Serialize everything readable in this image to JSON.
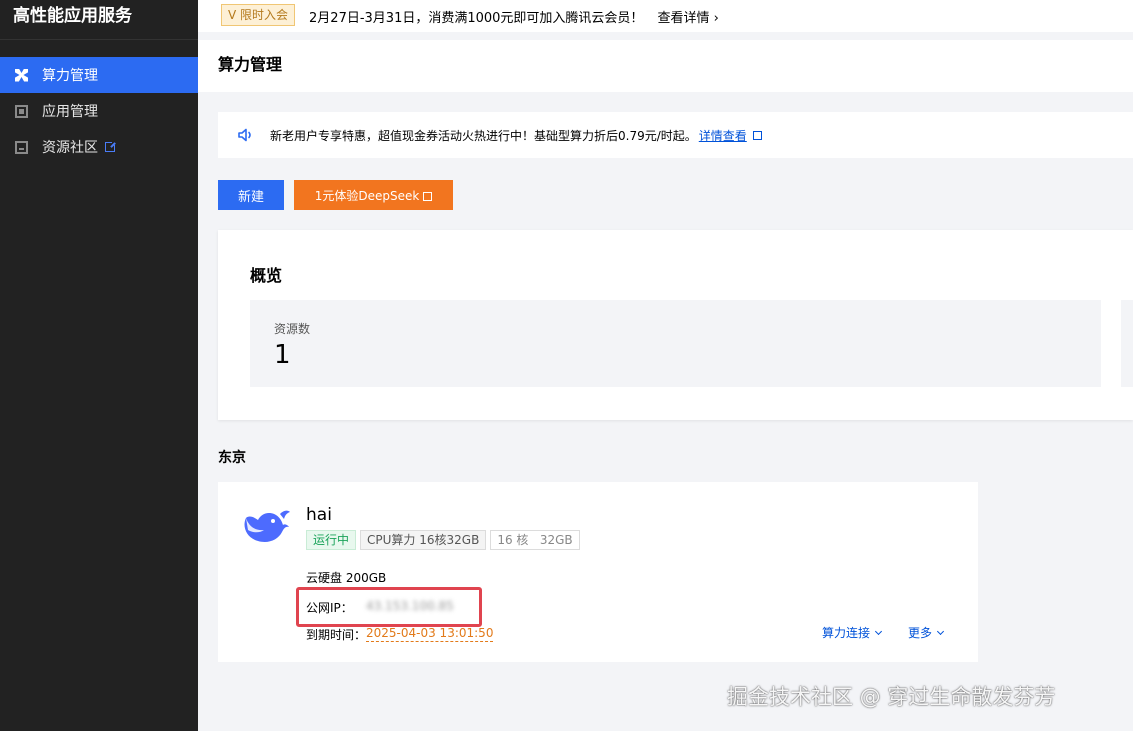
{
  "sidebar": {
    "app_title": "高性能应用服务",
    "items": [
      {
        "label": "算力管理",
        "active": true
      },
      {
        "label": "应用管理",
        "active": false
      },
      {
        "label": "资源社区",
        "active": false,
        "external": true
      }
    ]
  },
  "top_banner": {
    "tag": "V 限时入会",
    "text": "2月27日-3月31日，消费满1000元即可加入腾讯云会员！",
    "link": "查看详情 ›"
  },
  "page": {
    "title": "算力管理"
  },
  "notice": {
    "text": "新老用户专享特惠，超值现金券活动火热进行中！基础型算力折后0.79元/时起。",
    "link": "详情查看"
  },
  "toolbar": {
    "new_label": "新建",
    "deepseek_label": "1元体验DeepSeek"
  },
  "overview": {
    "title": "概览",
    "resource_label": "资源数",
    "resource_count": "1"
  },
  "region": {
    "name": "东京"
  },
  "instance": {
    "name": "hai",
    "status": "运行中",
    "spec": "CPU算力 16核32GB",
    "cores": "16 核",
    "memory": "32GB",
    "disk": "云硬盘 200GB",
    "ip_label": "公网IP：",
    "ip_value": "43.153.100.85",
    "expire_label": "到期时间：",
    "expire_value": "2025-04-03 13:01:50",
    "action_connect": "算力连接",
    "action_more": "更多"
  },
  "watermark": "掘金技术社区 @ 穿过生命散发芬芳",
  "colors": {
    "primary": "#2c6bf2",
    "orange": "#f2751f",
    "sidebar_bg": "#222222",
    "running": "#1aa35a",
    "highlight_box": "#e0444f"
  }
}
